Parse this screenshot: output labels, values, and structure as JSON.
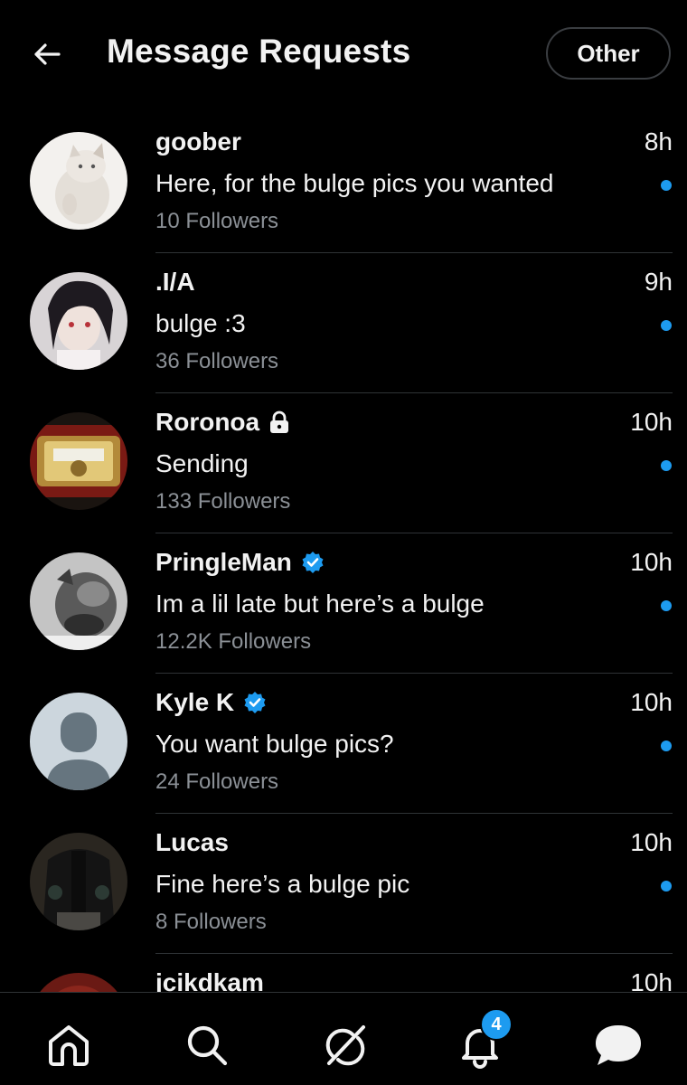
{
  "header": {
    "title": "Message Requests",
    "other_label": "Other"
  },
  "requests": [
    {
      "name": "goober",
      "time": "8h",
      "message": "Here, for the bulge pics you wanted",
      "followers": "10 Followers",
      "unread": true,
      "badge": null
    },
    {
      "name": ".I/A",
      "time": "9h",
      "message": "bulge :3",
      "followers": "36 Followers",
      "unread": true,
      "badge": null
    },
    {
      "name": "Roronoa",
      "time": "10h",
      "message": "Sending",
      "followers": "133 Followers",
      "unread": true,
      "badge": "lock-icon"
    },
    {
      "name": "PringleMan",
      "time": "10h",
      "message": "Im a lil late but here’s a bulge",
      "followers": "12.2K Followers",
      "unread": true,
      "badge": "verified-badge-icon"
    },
    {
      "name": "Kyle K",
      "time": "10h",
      "message": "You want bulge pics?",
      "followers": "24 Followers",
      "unread": true,
      "badge": "verified-badge-icon"
    },
    {
      "name": "Lucas",
      "time": "10h",
      "message": "Fine here’s a bulge pic",
      "followers": "8 Followers",
      "unread": true,
      "badge": null
    },
    {
      "name": "jcikdkam",
      "time": "10h"
    }
  ],
  "tabbar": {
    "items": [
      "home-icon",
      "search-icon",
      "grok-icon",
      "notifications-icon",
      "messages-icon"
    ],
    "notification_count": "4"
  },
  "colors": {
    "background": "#000000",
    "text": "#f2f2f2",
    "secondary_text": "#8b9096",
    "accent": "#1d9bf0",
    "divider": "#2f3336"
  }
}
